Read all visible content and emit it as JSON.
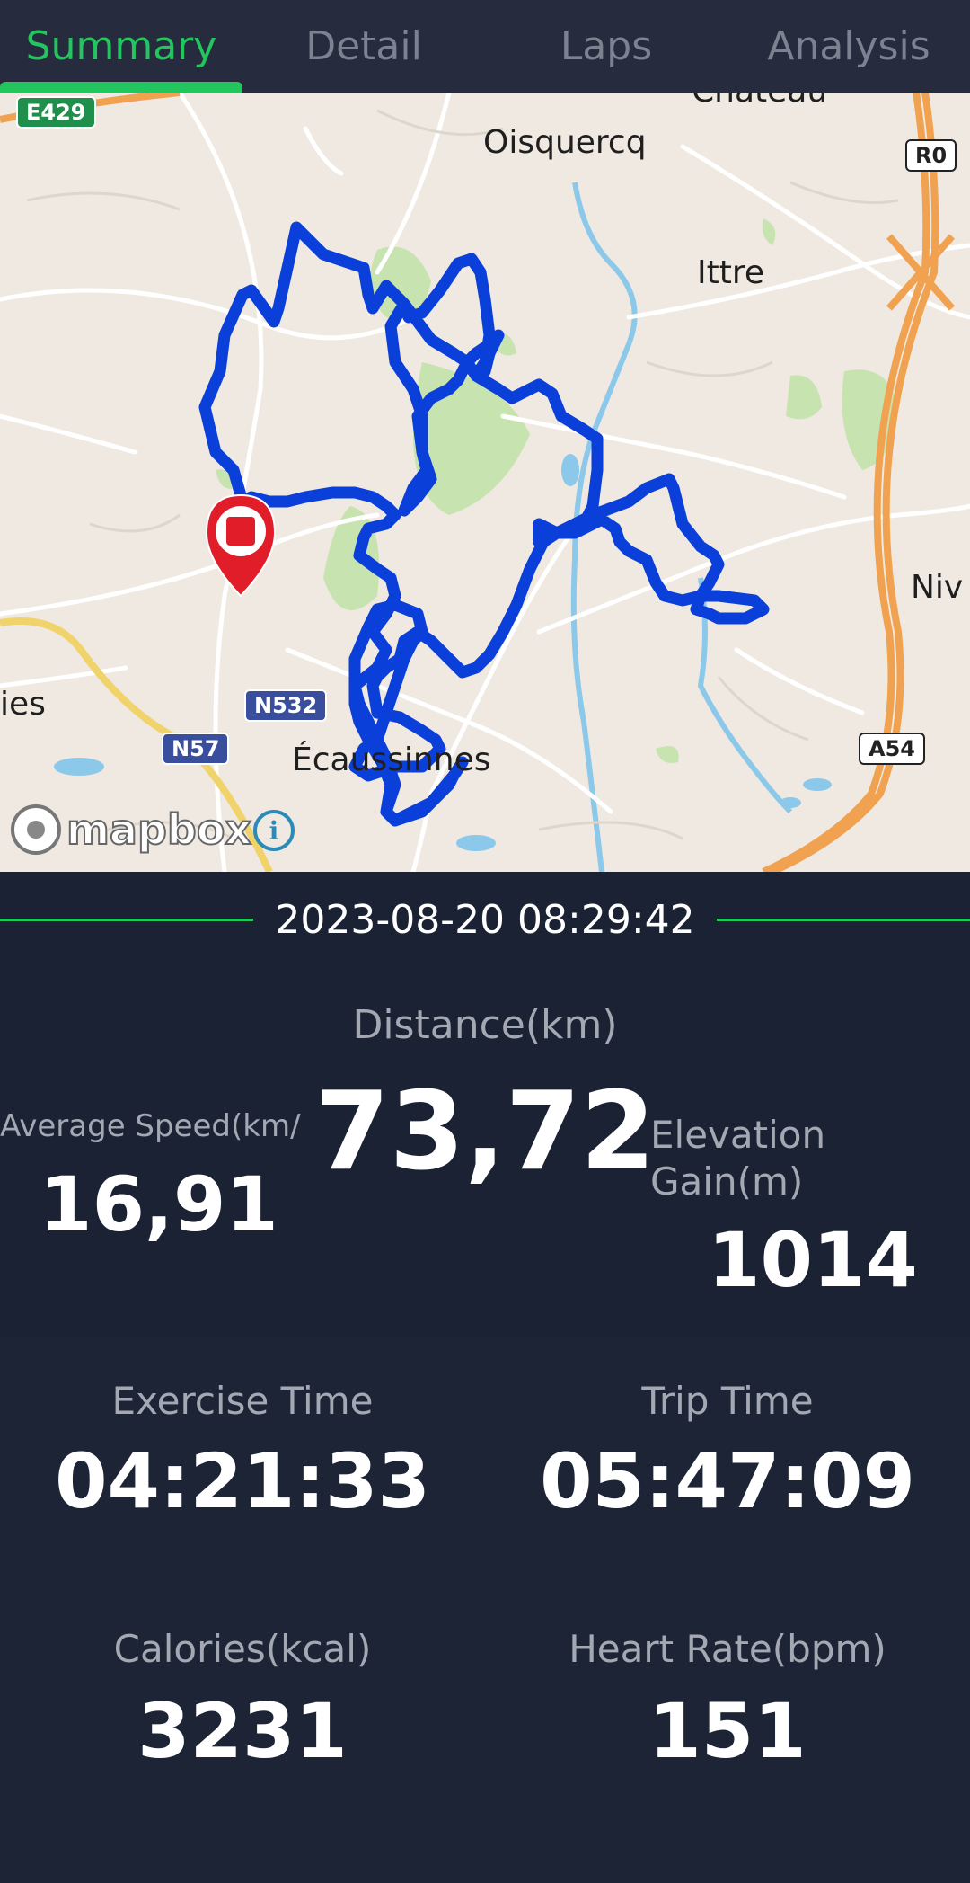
{
  "tabs": [
    {
      "label": "Summary",
      "active": true
    },
    {
      "label": "Detail",
      "active": false
    },
    {
      "label": "Laps",
      "active": false
    },
    {
      "label": "Analysis",
      "active": false
    }
  ],
  "map": {
    "places": {
      "chateau": "Château",
      "oisquercq": "Oisquercq",
      "ittre": "Ittre",
      "niv": "Niv",
      "ies": "ies",
      "ecaussinnes": "Écaussinnes"
    },
    "roads": {
      "e429": "E429",
      "r0": "R0",
      "n532": "N532",
      "n57": "N57",
      "a54": "A54"
    },
    "attribution": "mapbox",
    "info_glyph": "i",
    "route_color": "#0a3fd9",
    "marker_color": "#e11d2a",
    "marker_icon": "stop-square-icon"
  },
  "datetime": "2023-08-20 08:29:42",
  "stats": {
    "distance": {
      "label": "Distance(km)",
      "value": "73,72"
    },
    "avg_speed": {
      "label": "Average Speed(km/",
      "value": "16,91"
    },
    "elevation": {
      "label_line1": "Elevation",
      "label_line2": "Gain(m)",
      "value": "1014"
    },
    "exercise_time": {
      "label": "Exercise Time",
      "value": "04:21:33"
    },
    "trip_time": {
      "label": "Trip Time",
      "value": "05:47:09"
    },
    "calories": {
      "label": "Calories(kcal)",
      "value": "3231"
    },
    "heart_rate": {
      "label": "Heart Rate(bpm)",
      "value": "151"
    }
  },
  "colors": {
    "accent": "#22c55e",
    "background": "#1b2233",
    "label": "#a3a8b2",
    "value": "#ffffff"
  }
}
